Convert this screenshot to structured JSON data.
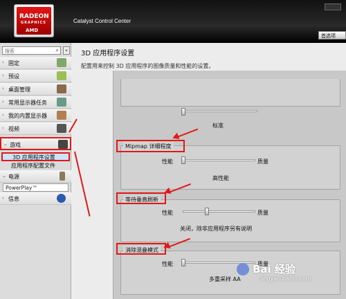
{
  "header": {
    "logo_brand": "RADEON",
    "logo_sub": "GRAPHICS",
    "logo_amd": "AMD",
    "app_title": "Catalyst Control Center",
    "preferences_label": "首选项"
  },
  "sidebar": {
    "search_placeholder": "搜索",
    "items": [
      {
        "label": "固定",
        "chevron": "›",
        "icon": "pin-icon"
      },
      {
        "label": "预设",
        "chevron": "›",
        "icon": "preset-icon"
      },
      {
        "label": "桌面管理",
        "chevron": "›",
        "icon": "desktop-icon"
      },
      {
        "label": "常用显示器任务",
        "chevron": "›",
        "icon": "display-icon"
      },
      {
        "label": "我的内置显示器",
        "chevron": "›",
        "icon": "laptop-icon"
      },
      {
        "label": "视频",
        "chevron": "›",
        "icon": "video-icon"
      },
      {
        "label": "游戏",
        "chevron": "⌄",
        "icon": "gamepad-icon"
      }
    ],
    "game_subitems": [
      "3D 应用程序设置",
      "应用程序配置文件"
    ],
    "power": {
      "label": "电源",
      "chevron": "⌄",
      "icon": "battery-icon"
    },
    "powerplay_label": "PowerPlay™",
    "info": {
      "label": "信息",
      "chevron": "›",
      "icon": "info-icon"
    }
  },
  "main": {
    "title": "3D 应用程序设置",
    "description": "配置用来控制 3D 应用程序的图像质量和性能的设置。",
    "settings": [
      {
        "group": "",
        "value_label": "标准",
        "left_label": "",
        "right_label": "",
        "level": 0.0
      },
      {
        "group": "Mipmap 详细程度",
        "value_label": "高性能",
        "left_label": "性能",
        "right_label": "质量",
        "level": 0.0
      },
      {
        "group": "等待垂直刷新",
        "value_label": "关闭，除非应用程序另有说明",
        "left_label": "性能",
        "right_label": "质量",
        "level": 0.33
      },
      {
        "group": "消除混叠模式",
        "value_label": "多重采样 AA",
        "left_label": "性能",
        "right_label": "质量",
        "level": 0.0
      }
    ]
  },
  "watermark": {
    "text": "Bai 经验",
    "url": "jingyan.baidu.com"
  },
  "colors": {
    "accent_red": "#e01818",
    "selection": "#cde3f7",
    "header_bg": "#111111"
  }
}
